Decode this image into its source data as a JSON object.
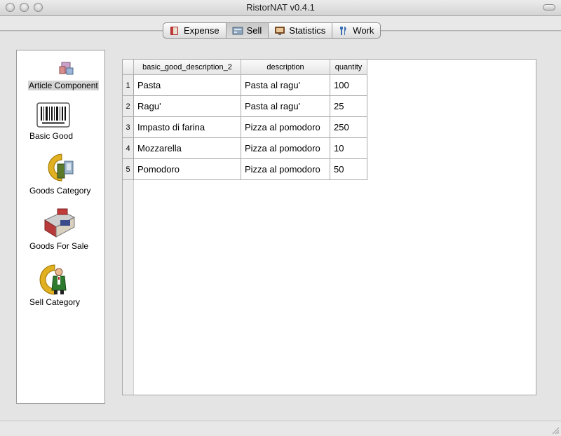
{
  "window": {
    "title": "RistorNAT v0.4.1"
  },
  "tabs": [
    {
      "label": "Expense",
      "icon": "expense-book-icon"
    },
    {
      "label": "Sell",
      "icon": "sell-register-icon",
      "active": true
    },
    {
      "label": "Statistics",
      "icon": "statistics-monitor-icon"
    },
    {
      "label": "Work",
      "icon": "fork-knife-icon"
    }
  ],
  "sidebar": {
    "items": [
      {
        "label": "Article Component",
        "icon": "article-component-icon",
        "selected": true
      },
      {
        "label": "Basic Good",
        "icon": "barcode-icon"
      },
      {
        "label": "Goods Category",
        "icon": "goods-category-icon"
      },
      {
        "label": "Goods For Sale",
        "icon": "cash-register-icon"
      },
      {
        "label": "Sell Category",
        "icon": "waiter-icon"
      }
    ]
  },
  "table": {
    "columns": [
      "basic_good_description_2",
      "description",
      "quantity"
    ],
    "rows": [
      {
        "n": "1",
        "basic_good": "Pasta",
        "description": "Pasta al ragu'",
        "quantity": "100"
      },
      {
        "n": "2",
        "basic_good": "Ragu'",
        "description": "Pasta al ragu'",
        "quantity": "25"
      },
      {
        "n": "3",
        "basic_good": "Impasto di farina",
        "description": "Pizza al pomodoro",
        "quantity": "250"
      },
      {
        "n": "4",
        "basic_good": "Mozzarella",
        "description": "Pizza al pomodoro",
        "quantity": "10"
      },
      {
        "n": "5",
        "basic_good": "Pomodoro",
        "description": "Pizza al pomodoro",
        "quantity": "50"
      }
    ]
  }
}
